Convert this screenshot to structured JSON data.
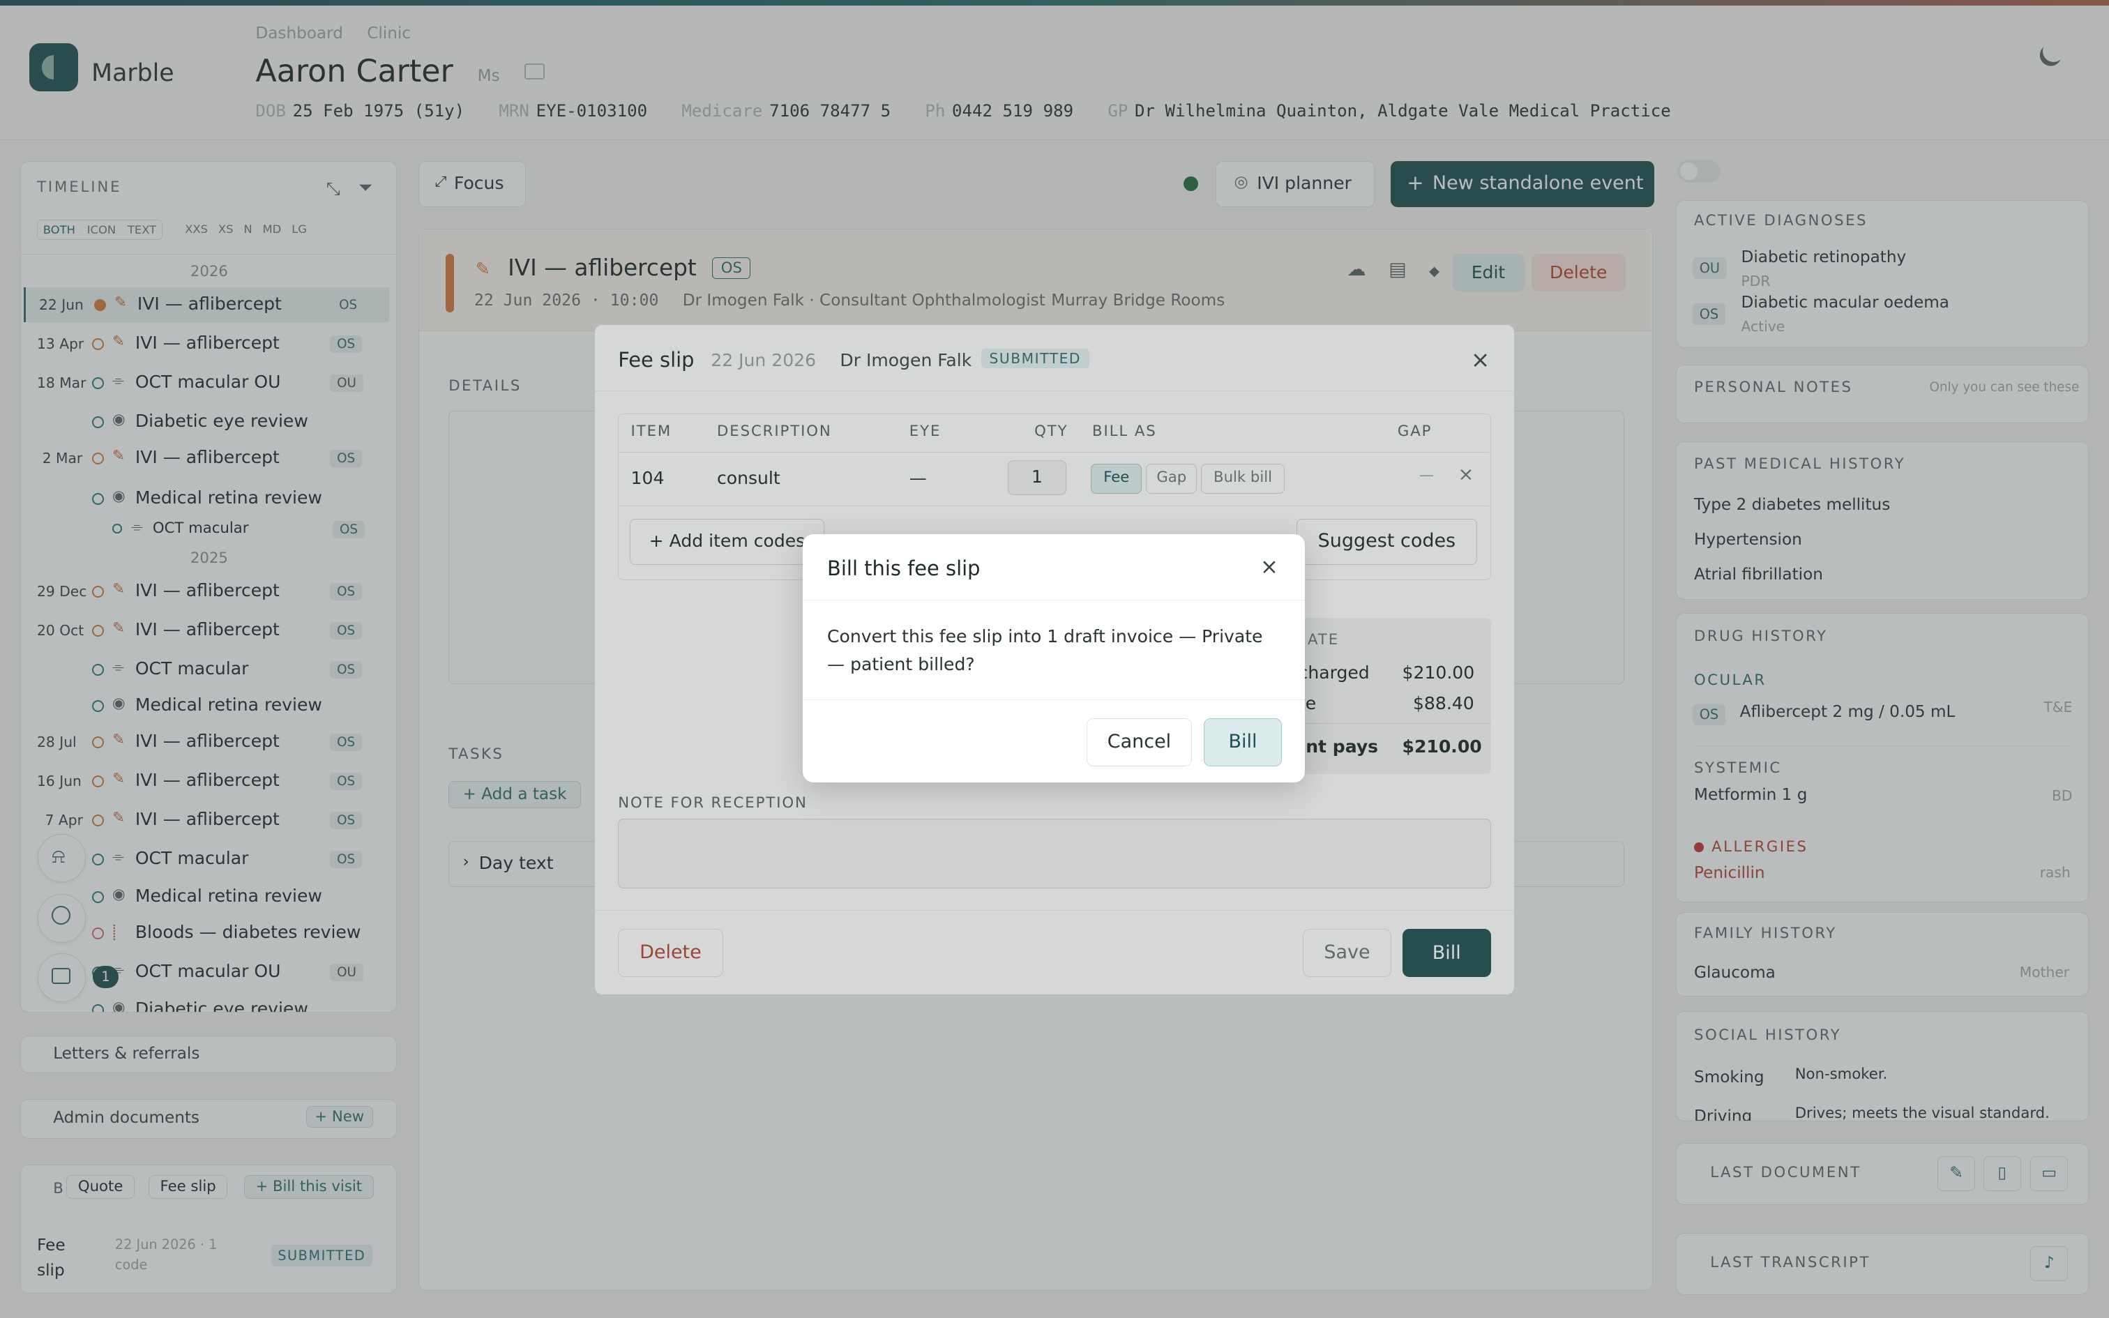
{
  "header": {
    "brand": "Marble",
    "breadcrumbs": [
      "Dashboard",
      "Clinic"
    ],
    "patient_name": "Aaron Carter",
    "patient_title": "Ms",
    "demographics": [
      {
        "key": "DOB",
        "value": "25 Feb 1975 (51y)"
      },
      {
        "key": "MRN",
        "value": "EYE-0103100"
      },
      {
        "key": "Medicare",
        "value": "7106 78477 5"
      },
      {
        "key": "Ph",
        "value": "0442 519 989"
      },
      {
        "key": "GP",
        "value": "Dr Wilhelmina Quainton, Aldgate Vale Medical Practice"
      }
    ]
  },
  "timeline": {
    "title": "TIMELINE",
    "view_modes": [
      "BOTH",
      "ICON",
      "TEXT"
    ],
    "sizes": [
      "XXS",
      "XS",
      "N",
      "MD",
      "LG"
    ],
    "years": [
      "2026",
      "2025"
    ],
    "rows": [
      {
        "date": "22 Jun",
        "label": "IVI — aflibercept",
        "eye": "OS"
      },
      {
        "date": "13 Apr",
        "label": "IVI — aflibercept",
        "eye": "OS"
      },
      {
        "date": "18 Mar",
        "label": "OCT macular OU",
        "eye": "OU"
      },
      {
        "date": "",
        "label": "Diabetic eye review",
        "eye": ""
      },
      {
        "date": "2 Mar",
        "label": "IVI — aflibercept",
        "eye": "OS"
      },
      {
        "date": "",
        "label": "Medical retina review",
        "eye": ""
      },
      {
        "date": "",
        "label": "OCT macular",
        "eye": "OS"
      },
      {
        "date": "29 Dec",
        "label": "IVI — aflibercept",
        "eye": "OS"
      },
      {
        "date": "20 Oct",
        "label": "IVI — aflibercept",
        "eye": "OS"
      },
      {
        "date": "",
        "label": "OCT macular",
        "eye": "OS"
      },
      {
        "date": "",
        "label": "Medical retina review",
        "eye": ""
      },
      {
        "date": "28 Jul",
        "label": "IVI — aflibercept",
        "eye": "OS"
      },
      {
        "date": "16 Jun",
        "label": "IVI — aflibercept",
        "eye": "OS"
      },
      {
        "date": "7 Apr",
        "label": "IVI — aflibercept",
        "eye": "OS"
      },
      {
        "date": "",
        "label": "OCT macular",
        "eye": "OS"
      },
      {
        "date": "",
        "label": "Medical retina review",
        "eye": ""
      },
      {
        "date": "",
        "label": "Bloods — diabetes review",
        "eye": ""
      },
      {
        "date": "",
        "label": "OCT macular OU",
        "eye": "OU"
      },
      {
        "date": "",
        "label": "Diabetic eye review",
        "eye": ""
      }
    ],
    "notification_count": "1"
  },
  "left_sections": {
    "letters": "Letters & referrals",
    "admin": "Admin documents",
    "admin_new": "+ New",
    "billing_tabs": [
      "B",
      "Quote",
      "Fee slip",
      "+ Bill this visit"
    ],
    "fee_slip_label": "Fee slip",
    "fee_slip_meta": "22 Jun 2026 · 1 code",
    "fee_slip_status": "SUBMITTED"
  },
  "center": {
    "focus": "Focus",
    "ivi_planner": "IVI planner",
    "new_event": "New standalone event",
    "event_title": "IVI — aflibercept",
    "event_eye": "OS",
    "event_meta": "22 Jun 2026 · 10:00",
    "event_doctor": "Dr Imogen Falk · Consultant Ophthalmologist",
    "event_location": "Murray Bridge Rooms",
    "edit": "Edit",
    "delete": "Delete",
    "details": "DETAILS",
    "tasks": "TASKS",
    "add_task": "+ Add a task",
    "day_text": "Day text"
  },
  "right": {
    "active_diagnoses": "ACTIVE DIAGNOSES",
    "diagnoses": [
      {
        "eye": "OU",
        "name": "Diabetic retinopathy",
        "status": "PDR"
      },
      {
        "eye": "OS",
        "name": "Diabetic macular oedema",
        "status": "Active"
      }
    ],
    "personal_notes": "PERSONAL NOTES",
    "personal_notes_hint": "Only you can see these",
    "pmh": "PAST MEDICAL HISTORY",
    "pmh_items": [
      "Type 2 diabetes mellitus",
      "Hypertension",
      "Atrial fibrillation"
    ],
    "drug_history": "DRUG HISTORY",
    "ocular": "OCULAR",
    "ocular_drug": {
      "eye": "OS",
      "name": "Aflibercept 2 mg / 0.05 mL",
      "freq": "T&E"
    },
    "systemic": "SYSTEMIC",
    "systemic_drug": {
      "name": "Metformin 1 g",
      "freq": "BD"
    },
    "allergies": "ALLERGIES",
    "allergy": {
      "name": "Penicillin",
      "reaction": "rash"
    },
    "family_history": "FAMILY HISTORY",
    "family": {
      "name": "Glaucoma",
      "relation": "Mother"
    },
    "social_history": "SOCIAL HISTORY",
    "social": [
      {
        "key": "Smoking",
        "value": "Non-smoker."
      },
      {
        "key": "Driving",
        "value": "Drives; meets the visual standard."
      }
    ],
    "last_document": "LAST DOCUMENT",
    "last_transcript": "LAST TRANSCRIPT"
  },
  "fee_modal": {
    "title": "Fee slip",
    "date": "22 Jun 2026",
    "doctor": "Dr Imogen Falk",
    "status": "SUBMITTED",
    "columns": [
      "ITEM",
      "DESCRIPTION",
      "EYE",
      "QTY",
      "BILL AS",
      "GAP"
    ],
    "row": {
      "item": "104",
      "description": "consult",
      "eye": "—",
      "qty": "1",
      "gap": "—"
    },
    "bill_as_options": [
      "Fee",
      "Gap",
      "Bulk bill"
    ],
    "add_item_codes": "+ Add item codes",
    "suggest_codes": "Suggest codes",
    "estimate_title": "IMATE",
    "estimate": [
      {
        "label": "l charged",
        "value": "$210.00"
      },
      {
        "label": "ate",
        "value": "$88.40"
      },
      {
        "label": "ient pays",
        "value": "$210.00"
      }
    ],
    "note_label": "NOTE FOR RECEPTION",
    "delete": "Delete",
    "save": "Save",
    "bill": "Bill"
  },
  "confirm_dialog": {
    "title": "Bill this fee slip",
    "message": "Convert this fee slip into 1 draft invoice — Private — patient billed?",
    "cancel": "Cancel",
    "bill": "Bill"
  },
  "colors": {
    "accent": "#1f4f4f",
    "brand_teal": "#2f6d6d",
    "danger": "#c0392b",
    "orange": "#d87a3a"
  }
}
